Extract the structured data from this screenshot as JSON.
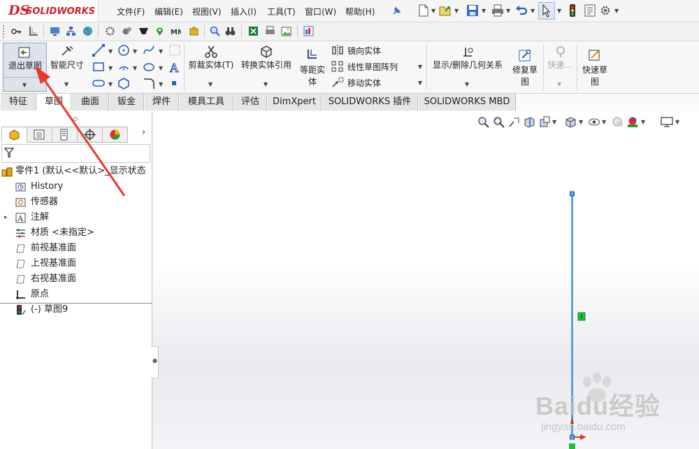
{
  "app": {
    "logo_ds": "DS",
    "logo_text": "SOLIDWORKS"
  },
  "menu": {
    "items": [
      "文件(F)",
      "编辑(E)",
      "视图(V)",
      "插入(I)",
      "工具(T)",
      "窗口(W)",
      "帮助(H)"
    ]
  },
  "ribbon": {
    "exit_sketch": "退出草图",
    "smart_dimension": "智能尺寸",
    "trim_entities": "剪裁实体(T)",
    "convert_entities": "转换实体引用",
    "offset_entities_line1": "等距实",
    "offset_entities_line2": "体",
    "mirror_entities": "镜向实体",
    "linear_pattern": "线性草图阵列",
    "move_entities": "移动实体",
    "display_relations": "显示/删除几何关系",
    "repair_sketch_line1": "修复草",
    "repair_sketch_line2": "图",
    "quick_snaps_disabled": "快速...",
    "rapid_sketch_line1": "快速草",
    "rapid_sketch_line2": "图"
  },
  "tabs": [
    "特征",
    "草图",
    "曲面",
    "钣金",
    "焊件",
    "模具工具",
    "评估",
    "DimXpert",
    "SOLIDWORKS 插件",
    "SOLIDWORKS MBD"
  ],
  "active_tab": "草图",
  "tree": {
    "root": "零件1  (默认<<默认>_显示状态",
    "items": [
      "History",
      "传感器",
      "注解",
      "材质 <未指定>",
      "前视基准面",
      "上视基准面",
      "右视基准面",
      "原点",
      "(-) 草图9"
    ]
  },
  "watermark": {
    "brand": "Baidu经验",
    "url": "jingyan.baidu.com"
  },
  "colors": {
    "brand_red": "#d11f26",
    "sketch_line": "#3d8fe8",
    "relation_green": "#22c03a",
    "arrow_red": "#e8392f"
  }
}
